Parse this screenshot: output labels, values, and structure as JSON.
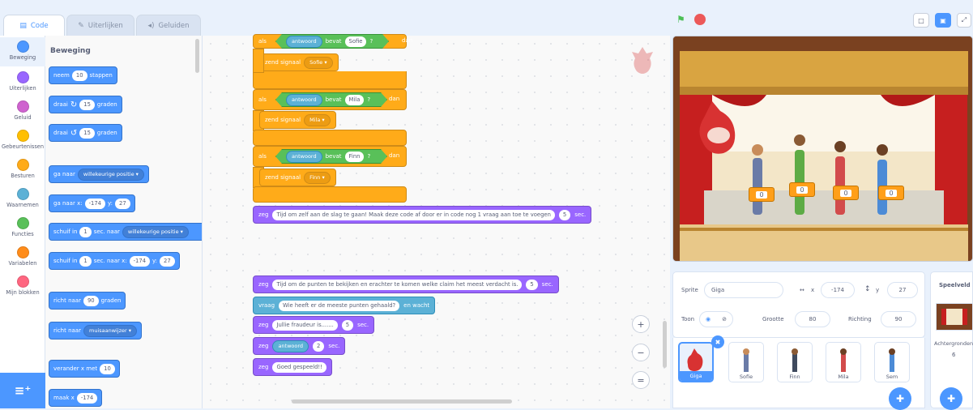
{
  "tabs": [
    {
      "label": "Code",
      "icon": "code-icon"
    },
    {
      "label": "Uiterlijken",
      "icon": "brush-icon"
    },
    {
      "label": "Geluiden",
      "icon": "speaker-icon"
    }
  ],
  "categories": [
    {
      "label": "Beweging",
      "color": "#4c97ff"
    },
    {
      "label": "Uiterlijken",
      "color": "#9966ff"
    },
    {
      "label": "Geluid",
      "color": "#cf63cf"
    },
    {
      "label": "Gebeurtenissen",
      "color": "#ffbf00"
    },
    {
      "label": "Besturen",
      "color": "#ffab19"
    },
    {
      "label": "Waarnemen",
      "color": "#5cb1d6"
    },
    {
      "label": "Functies",
      "color": "#59c059"
    },
    {
      "label": "Variabelen",
      "color": "#ff8c1a"
    },
    {
      "label": "Mijn blokken",
      "color": "#ff6680"
    }
  ],
  "palette": {
    "title": "Beweging",
    "move": {
      "a": "neem",
      "n": "10",
      "b": "stappen"
    },
    "turn_right": {
      "a": "draai",
      "n": "15",
      "b": "graden"
    },
    "turn_left": {
      "a": "draai",
      "n": "15",
      "b": "graden"
    },
    "goto": {
      "a": "ga naar",
      "d": "willekeurige positie"
    },
    "goto_xy": {
      "a": "ga naar x:",
      "x": "-174",
      "y_label": "y:",
      "y": "27"
    },
    "glide": {
      "a": "schuif in",
      "n": "1",
      "b": "sec. naar",
      "d": "willekeurige positie"
    },
    "glide_xy": {
      "a": "schuif in",
      "n": "1",
      "b": "sec. naar x:",
      "x": "-174",
      "y_label": "y:",
      "y": "27"
    },
    "point": {
      "a": "richt naar",
      "n": "90",
      "b": "graden"
    },
    "point_to": {
      "a": "richt naar",
      "d": "muisaanwijzer"
    },
    "change_x": {
      "a": "verander x met",
      "n": "10"
    },
    "set_x": {
      "a": "maak x",
      "n": "-174"
    }
  },
  "script": {
    "if_label": "als",
    "then_label": "dan",
    "contains_label": "bevat",
    "q": "?",
    "answer_label": "antwoord",
    "broadcast_label": "zend signaal",
    "ifs": [
      {
        "name": "Sofie"
      },
      {
        "name": "Mila"
      },
      {
        "name": "Finn"
      }
    ],
    "say1": {
      "a": "zeg",
      "text": "Tijd om zelf aan de slag te gaan! Maak deze code af door er in code nog 1 vraag aan toe te voegen",
      "n": "5",
      "b": "sec."
    },
    "say2": {
      "a": "zeg",
      "text": "Tijd om de punten te bekijken en erachter te komen welke claim het meest verdacht is.",
      "n": "5",
      "b": "sec."
    },
    "ask": {
      "a": "vraag",
      "text": "Wie heeft er de meeste punten gehaald?",
      "b": "en wacht"
    },
    "say3": {
      "a": "zeg",
      "text": "Jullie fraudeur is.......",
      "n": "5",
      "b": "sec."
    },
    "say4": {
      "a": "zeg",
      "text": "antwoord",
      "n": "2",
      "b": "sec."
    },
    "say5": {
      "a": "zeg",
      "text": "Goed gespeeld!!"
    }
  },
  "stage": {
    "scores": [
      "0",
      "0",
      "0",
      "0"
    ]
  },
  "sprite_info": {
    "sprite_label": "Sprite",
    "sprite_name": "Giga",
    "x_label": "x",
    "x": "-174",
    "y_label": "y",
    "y": "27",
    "show_label": "Toon",
    "size_label": "Grootte",
    "size": "80",
    "dir_label": "Richting",
    "dir": "90"
  },
  "sprites": [
    {
      "name": "Giga"
    },
    {
      "name": "Sofie"
    },
    {
      "name": "Finn"
    },
    {
      "name": "Mila"
    },
    {
      "name": "Sem"
    }
  ],
  "backdrop": {
    "title": "Speelveld",
    "label": "Achtergronden",
    "count": "6"
  }
}
